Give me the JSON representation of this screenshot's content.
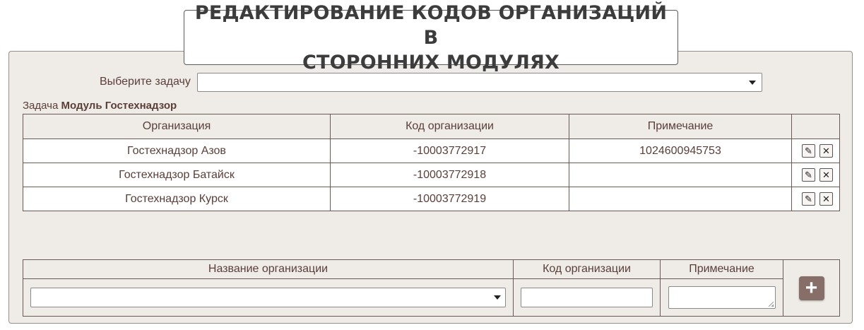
{
  "page": {
    "title": "РЕДАКТИРОВАНИЕ КОДОВ ОРГАНИЗАЦИЙ В\nСТОРОННИХ МОДУЛЯХ"
  },
  "task_select": {
    "label": "Выберите задачу",
    "value": ""
  },
  "task": {
    "prefix": "Задача",
    "name": "Модуль Гостехнадзор"
  },
  "table": {
    "headers": [
      "Организация",
      "Код организации",
      "Примечание",
      ""
    ],
    "rows": [
      {
        "org": "Гостехнадзор Азов",
        "code": "-10003772917",
        "note": "1024600945753"
      },
      {
        "org": "Гостехнадзор Батайск",
        "code": "-10003772918",
        "note": ""
      },
      {
        "org": "Гостехнадзор Курск",
        "code": "-10003772919",
        "note": ""
      }
    ],
    "edit_icon": "pencil-icon",
    "delete_icon": "close-icon"
  },
  "add_form": {
    "headers": [
      "Название организации",
      "Код организации",
      "Примечание"
    ],
    "org_value": "",
    "code_value": "",
    "note_value": "",
    "add_icon": "plus-icon"
  },
  "colors": {
    "panel_bg": "#efebe7",
    "text": "#5a3f38",
    "add_button": "#876e69"
  }
}
